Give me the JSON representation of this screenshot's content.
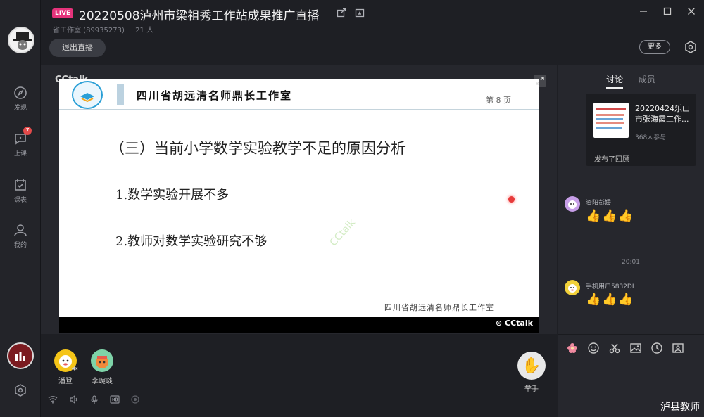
{
  "header": {
    "live_tag": "LIVE",
    "title": "20220508泸州市梁祖秀工作站成果推广直播",
    "subtitle_org": "省工作室 (89935273)",
    "subtitle_count": "21 人",
    "exit_label": "退出直播",
    "more_label": "更多"
  },
  "sidebar": {
    "items": [
      {
        "label": "发现",
        "icon": "compass-icon"
      },
      {
        "label": "上课",
        "icon": "chat-bubble-icon",
        "badge": "7"
      },
      {
        "label": "课表",
        "icon": "calendar-check-icon"
      },
      {
        "label": "我的",
        "icon": "person-icon"
      }
    ]
  },
  "video": {
    "brand_mark": "CCtalk",
    "slide": {
      "brand": "四川省胡远清名师鼎长工作室",
      "page": "第 8 页",
      "heading": "（三）当前小学数学实验教学不足的原因分析",
      "point1": "1.数学实验开展不多",
      "point2": "2.教师对数学实验研究不够",
      "footer": "四川省胡远清名师鼎长工作室",
      "watermark": "CCtalk"
    },
    "bar_logo": "⊙ CCtalk"
  },
  "participants": [
    {
      "name": "潘登",
      "color": "#f5c518"
    },
    {
      "name": "李琬琰",
      "color": "#7ed3a8"
    }
  ],
  "raise_hand": {
    "label": "举手"
  },
  "panel": {
    "tabs": [
      {
        "label": "讨论",
        "active": true
      },
      {
        "label": "成员",
        "active": false
      }
    ],
    "card": {
      "title": "20220424乐山市张海霞工作...",
      "count": "368人参与",
      "footer": "发布了回顾"
    },
    "messages": [
      {
        "name": "资阳彭媛",
        "content": "👍👍👍",
        "avatar_color": "#c79ee8"
      },
      {
        "name": "手机用户5832DL",
        "content": "👍👍👍",
        "avatar_color": "#f2d13a"
      }
    ],
    "time_separator": "20:01"
  },
  "watermark_footer": "泸县教师",
  "colors": {
    "background": "#1e1f24",
    "panel": "#26272d",
    "live_tag": "#e5337b",
    "badge": "#e34a4a"
  }
}
